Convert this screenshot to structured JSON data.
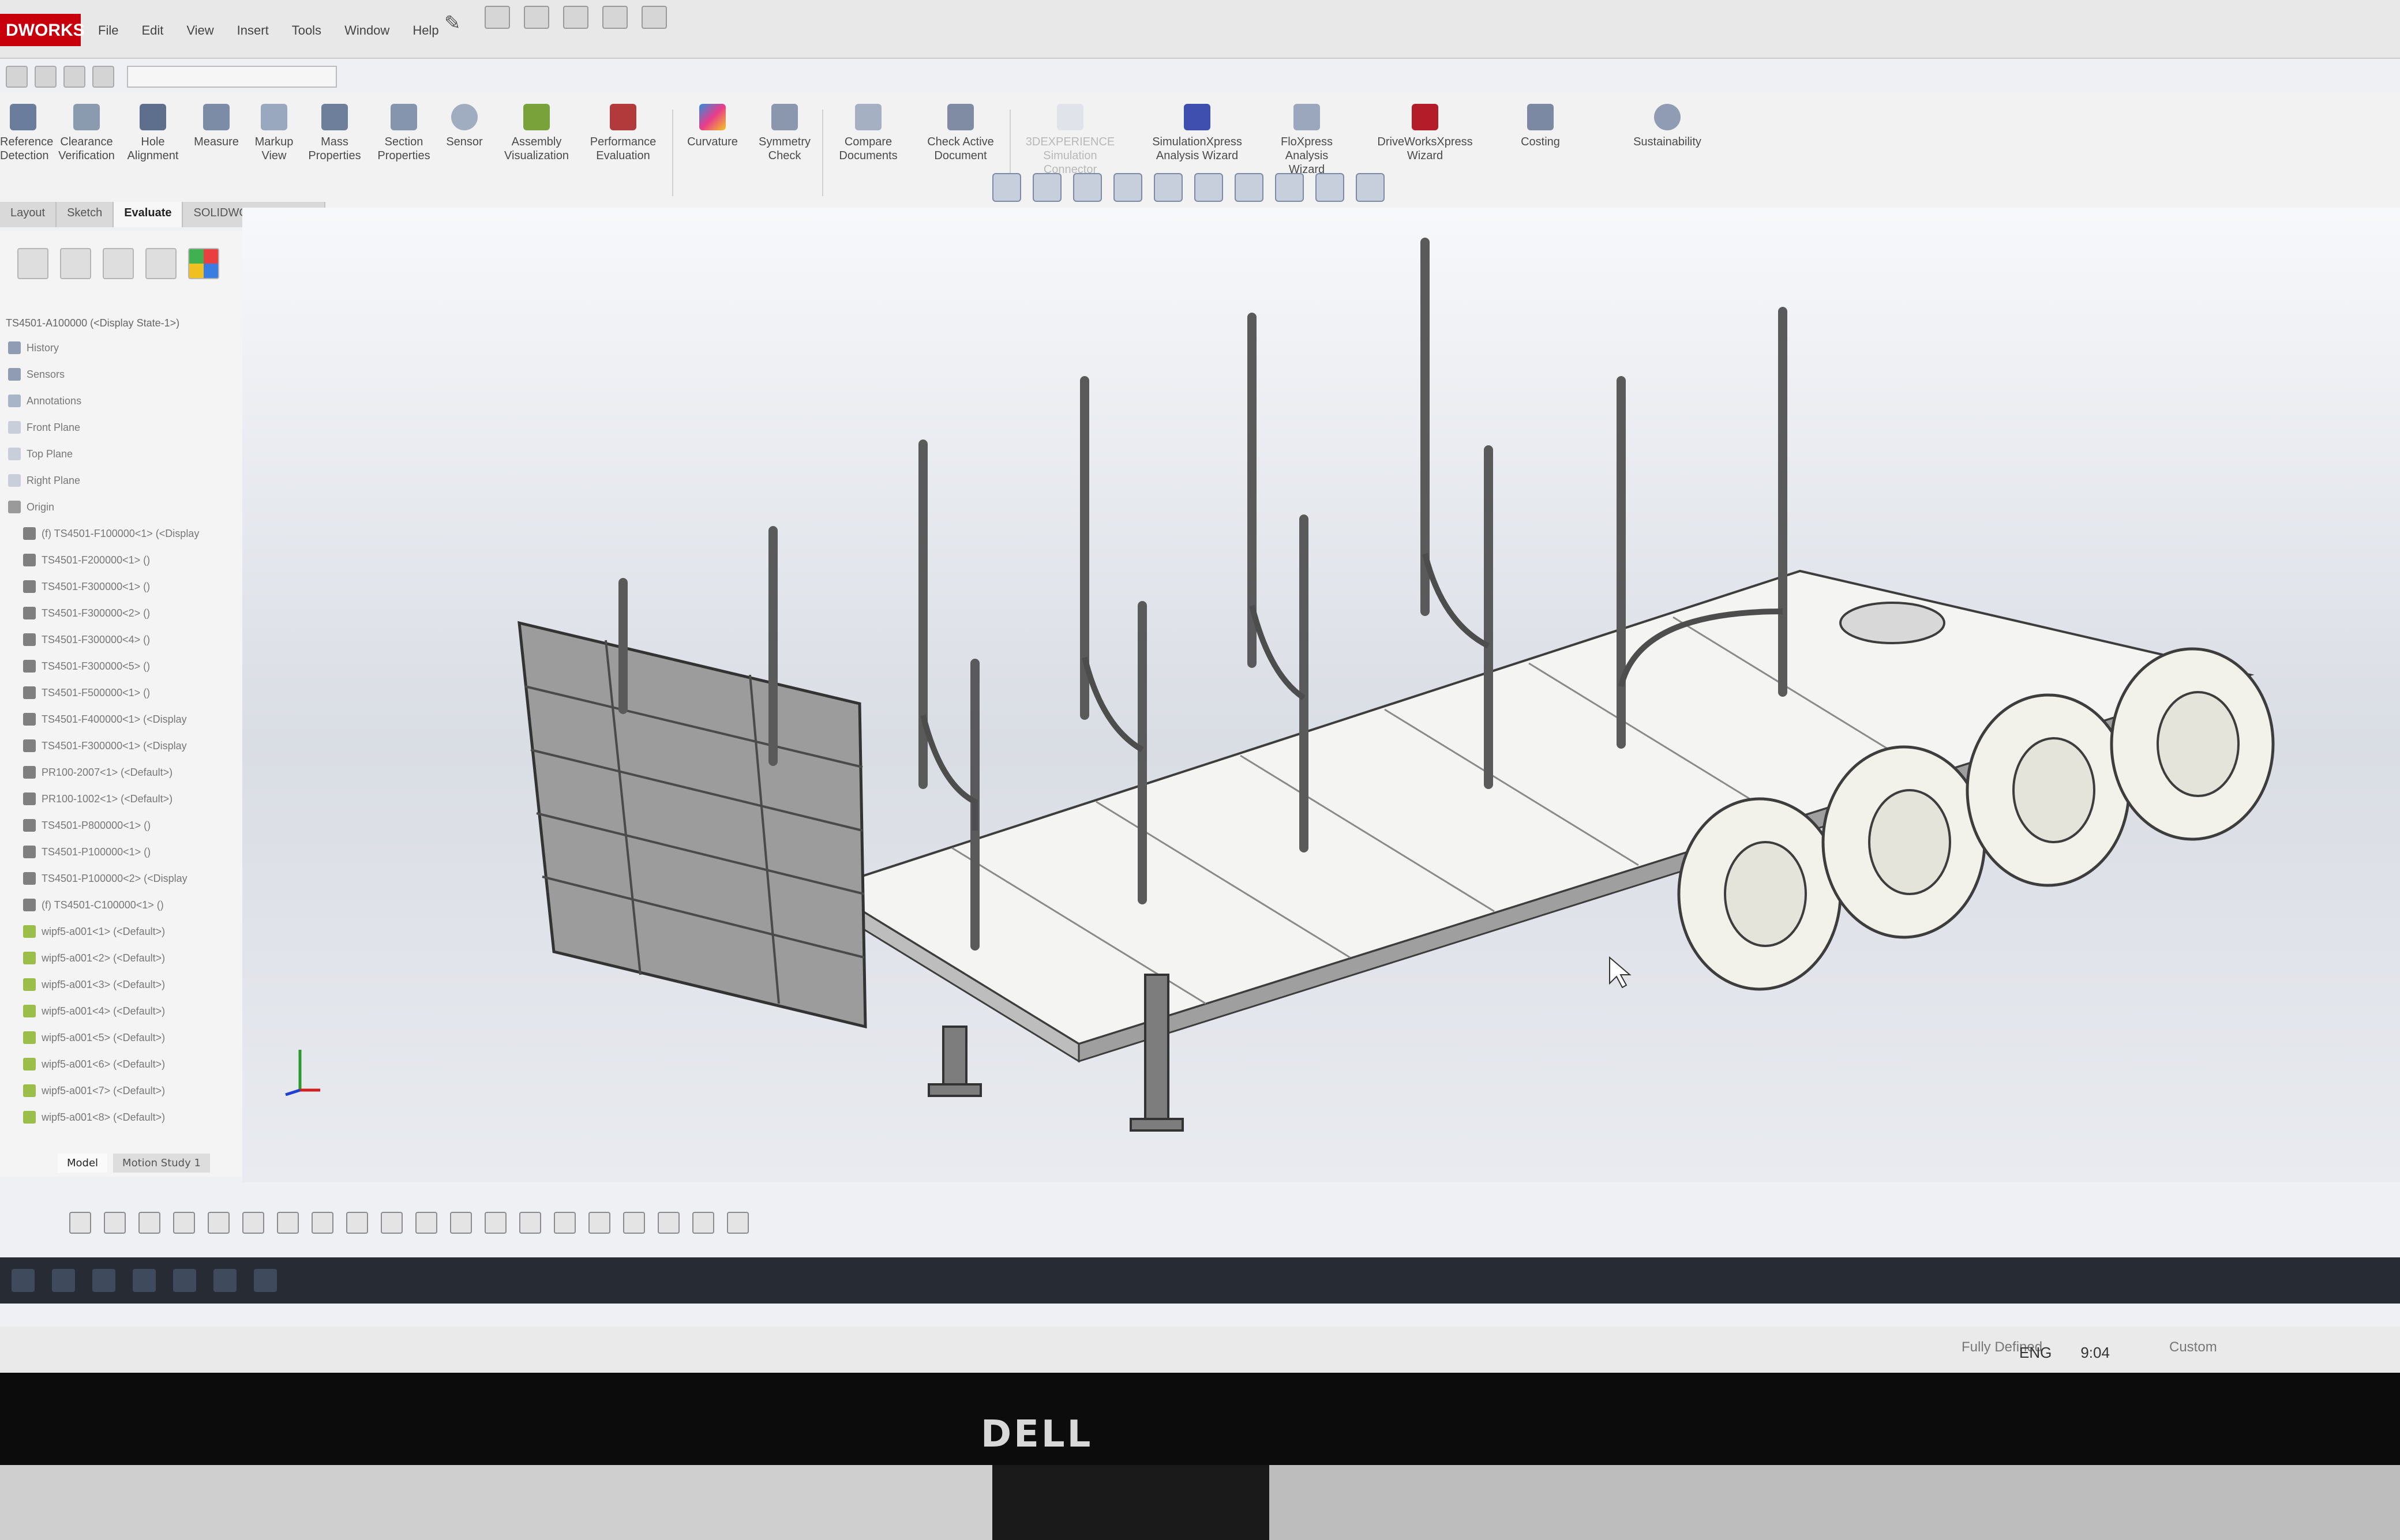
{
  "app": {
    "brand": "DWORKS",
    "menu": [
      "File",
      "Edit",
      "View",
      "Insert",
      "Tools",
      "Window",
      "Help"
    ]
  },
  "ribbon": {
    "buttons": [
      {
        "label": "Reference\nDetection",
        "icon": "reference-detection-icon"
      },
      {
        "label": "Clearance\nVerification",
        "icon": "clearance-icon"
      },
      {
        "label": "Hole\nAlignment",
        "icon": "hole-alignment-icon"
      },
      {
        "label": "Measure",
        "icon": "measure-icon"
      },
      {
        "label": "Markup\nView",
        "icon": "markup-icon"
      },
      {
        "label": "Mass\nProperties",
        "icon": "mass-properties-icon"
      },
      {
        "label": "Section\nProperties",
        "icon": "section-properties-icon"
      },
      {
        "label": "Sensor",
        "icon": "sensor-icon"
      },
      {
        "label": "Assembly\nVisualization",
        "icon": "assembly-visualization-icon"
      },
      {
        "label": "Performance\nEvaluation",
        "icon": "performance-icon"
      },
      {
        "label": "Curvature",
        "icon": "curvature-icon"
      },
      {
        "label": "Symmetry\nCheck",
        "icon": "symmetry-icon"
      },
      {
        "label": "Compare\nDocuments",
        "icon": "compare-icon"
      },
      {
        "label": "Check Active\nDocument",
        "icon": "check-icon"
      },
      {
        "label": "3DEXPERIENCE\nSimulation\nConnector",
        "icon": "3dx-icon"
      },
      {
        "label": "SimulationXpress\nAnalysis Wizard",
        "icon": "simulationxpress-icon"
      },
      {
        "label": "FloXpress\nAnalysis\nWizard",
        "icon": "floxpress-icon"
      },
      {
        "label": "DriveWorksXpress\nWizard",
        "icon": "driveworks-icon"
      },
      {
        "label": "Costing",
        "icon": "costing-icon"
      },
      {
        "label": "Sustainability",
        "icon": "sustainability-icon"
      }
    ]
  },
  "tabs": [
    "Layout",
    "Sketch",
    "Evaluate",
    "SOLIDWORKS Add-Ins"
  ],
  "active_tab": "Evaluate",
  "feature_tree": {
    "root": "TS4501-A100000 (<Display State-1>)",
    "items": [
      "History",
      "Sensors",
      "Annotations",
      "Front Plane",
      "Top Plane",
      "Right Plane",
      "Origin",
      "(f) TS4501-F100000<1> (<Display",
      "TS4501-F200000<1> ()",
      "TS4501-F300000<1> ()",
      "TS4501-F300000<2> ()",
      "TS4501-F300000<4> ()",
      "TS4501-F300000<5> ()",
      "TS4501-F500000<1> ()",
      "TS4501-F400000<1> (<Display",
      "TS4501-F300000<1> (<Display",
      "PR100-2007<1> (<Default>)",
      "PR100-1002<1> (<Default>)",
      "TS4501-P800000<1> ()",
      "TS4501-P100000<1> ()",
      "TS4501-P100000<2> (<Display",
      "(f) TS4501-C100000<1> ()",
      "wipf5-a001<1> (<Default>)",
      "wipf5-a001<2> (<Default>)",
      "wipf5-a001<3> (<Default>)",
      "wipf5-a001<4> (<Default>)",
      "wipf5-a001<5> (<Default>)",
      "wipf5-a001<6> (<Default>)",
      "wipf5-a001<7> (<Default>)",
      "wipf5-a001<8> (<Default>)"
    ]
  },
  "bottom_tabs": [
    "Model",
    "Motion Study 1"
  ],
  "status": {
    "left": "",
    "defined": "Fully Defined",
    "units": "Custom"
  },
  "tray": {
    "lang": "ENG",
    "time": "9:04"
  },
  "monitor_brand": "DELL",
  "colors": {
    "brand_red": "#c7000b",
    "viewport_top": "#f7f8fb",
    "model_fill": "#f4f4f2",
    "model_stroke": "#3d3d3d"
  }
}
